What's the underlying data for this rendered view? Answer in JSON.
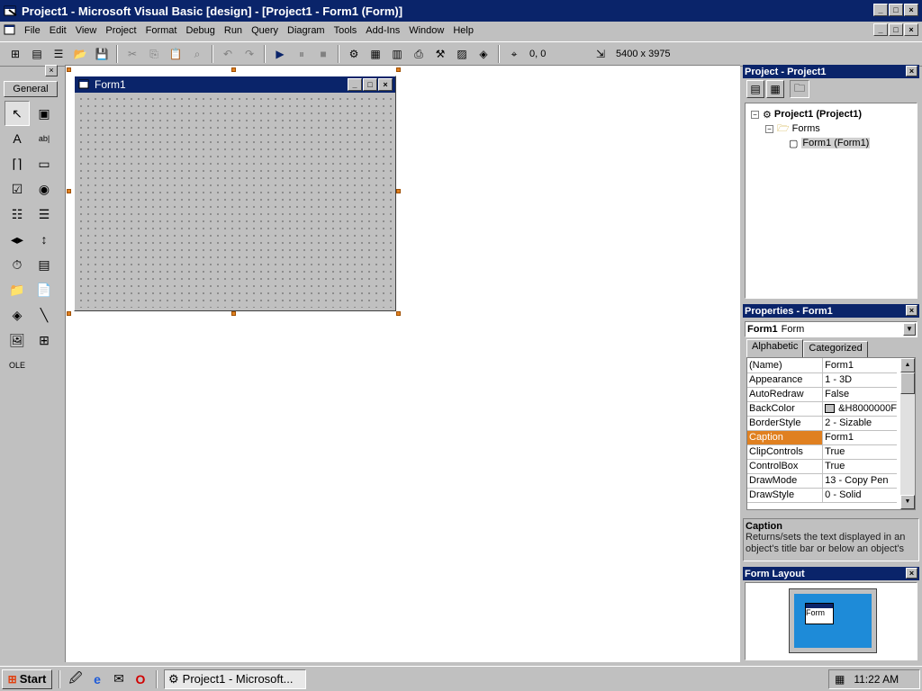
{
  "window": {
    "title": "Project1 - Microsoft Visual Basic [design] - [Project1 - Form1 (Form)]",
    "buttons": {
      "minimize": "_",
      "maximize": "□",
      "close": "×"
    }
  },
  "menu": {
    "items": [
      "File",
      "Edit",
      "View",
      "Project",
      "Format",
      "Debug",
      "Run",
      "Query",
      "Diagram",
      "Tools",
      "Add-Ins",
      "Window",
      "Help"
    ]
  },
  "toolbar": {
    "position": "0, 0",
    "size": "5400 x 3975"
  },
  "toolbox": {
    "tab_label": "General",
    "close": "×",
    "tools": [
      {
        "name": "pointer-tool",
        "glyph": "↖"
      },
      {
        "name": "picturebox-tool",
        "glyph": "▣"
      },
      {
        "name": "label-tool",
        "glyph": "A"
      },
      {
        "name": "textbox-tool",
        "glyph": "ab|"
      },
      {
        "name": "frame-tool",
        "glyph": "⌈⌉"
      },
      {
        "name": "commandbutton-tool",
        "glyph": "▭"
      },
      {
        "name": "checkbox-tool",
        "glyph": "☑"
      },
      {
        "name": "optionbutton-tool",
        "glyph": "◉"
      },
      {
        "name": "combobox-tool",
        "glyph": "☷"
      },
      {
        "name": "listbox-tool",
        "glyph": "☰"
      },
      {
        "name": "hscrollbar-tool",
        "glyph": "◂▸"
      },
      {
        "name": "vscrollbar-tool",
        "glyph": "↕"
      },
      {
        "name": "timer-tool",
        "glyph": "⏱"
      },
      {
        "name": "drivelistbox-tool",
        "glyph": "▤"
      },
      {
        "name": "dirlistbox-tool",
        "glyph": "📁"
      },
      {
        "name": "filelistbox-tool",
        "glyph": "📄"
      },
      {
        "name": "shape-tool",
        "glyph": "◈"
      },
      {
        "name": "line-tool",
        "glyph": "╲"
      },
      {
        "name": "image-tool",
        "glyph": "🖼"
      },
      {
        "name": "data-tool",
        "glyph": "⊞"
      },
      {
        "name": "ole-tool",
        "glyph": "OLE"
      }
    ]
  },
  "form": {
    "title": "Form1"
  },
  "project_panel": {
    "title": "Project - Project1",
    "tree": [
      {
        "label": "Project1 (Project1)",
        "bold": true
      },
      {
        "label": "Forms"
      },
      {
        "label": "Form1 (Form1)"
      }
    ]
  },
  "properties_panel": {
    "title": "Properties - Form1",
    "object_name": "Form1",
    "object_type": "Form",
    "tabs": [
      "Alphabetic",
      "Categorized"
    ],
    "rows": [
      {
        "name": "(Name)",
        "value": "Form1"
      },
      {
        "name": "Appearance",
        "value": "1 - 3D"
      },
      {
        "name": "AutoRedraw",
        "value": "False"
      },
      {
        "name": "BackColor",
        "value": "&H8000000F"
      },
      {
        "name": "BorderStyle",
        "value": "2 - Sizable"
      },
      {
        "name": "Caption",
        "value": "Form1"
      },
      {
        "name": "ClipControls",
        "value": "True"
      },
      {
        "name": "ControlBox",
        "value": "True"
      },
      {
        "name": "DrawMode",
        "value": "13 - Copy Pen"
      },
      {
        "name": "DrawStyle",
        "value": "0 - Solid"
      }
    ],
    "desc_title": "Caption",
    "desc_text": "Returns/sets the text displayed in an object's title bar or below an object's"
  },
  "layout_panel": {
    "title": "Form Layout",
    "mini_label": "Form"
  },
  "taskbar": {
    "start": "Start",
    "task_item": "Project1 - Microsoft...",
    "clock": "11:22 AM"
  },
  "colors": {
    "titlebar": "#0a246a",
    "selection": "#e08020",
    "face": "#c0c0c0"
  }
}
